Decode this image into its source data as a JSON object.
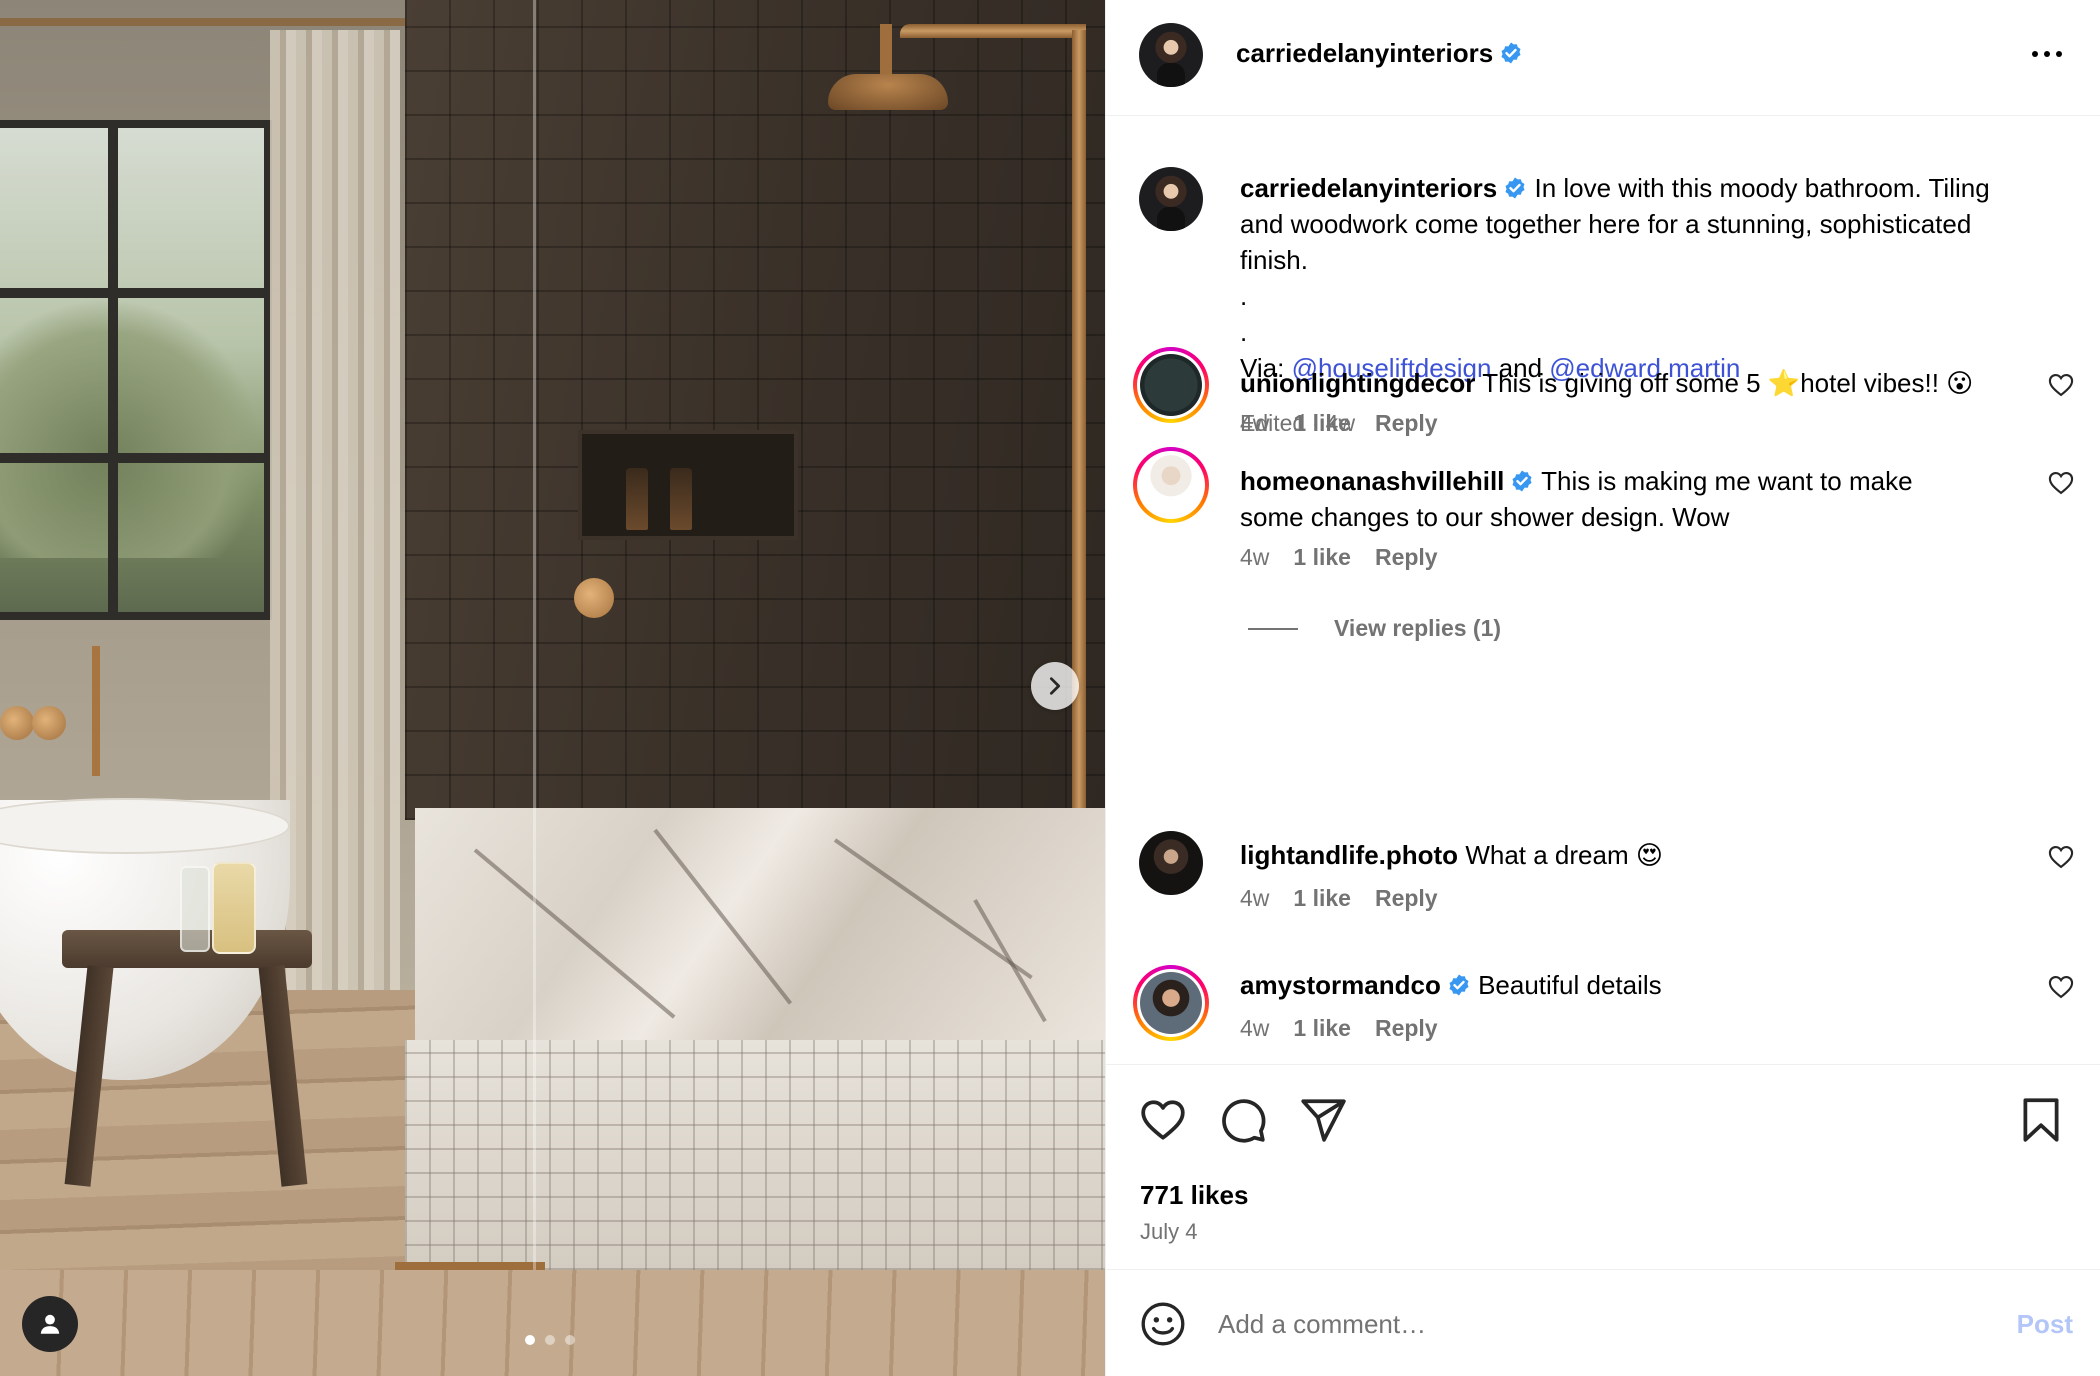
{
  "post": {
    "username": "carriedelanyinteriors",
    "verified": true,
    "carousel": {
      "slide_count": 3,
      "active_slide": 1
    }
  },
  "caption": {
    "username": "carriedelanyinteriors",
    "text_line1": "In love with this moody bathroom. Tiling",
    "text_line2": "and woodwork come together here for a stunning, sophisticated",
    "text_line3": "finish.",
    "dot1": ".",
    "dot2": ".",
    "via_prefix": "Via: ",
    "mention1": "@houseliftdesign",
    "and": " and ",
    "mention2": "@edward.martin",
    "meta": "Edited · 4w"
  },
  "comments": [
    {
      "username": "unionlightingdecor",
      "verified": false,
      "text": "This is giving off some 5 ⭐hotel vibes!! 😮",
      "time": "4w",
      "likes": "1 like",
      "reply": "Reply"
    },
    {
      "username": "homeonanashvillehill",
      "verified": true,
      "text_line1": "This is making me want to make",
      "text_line2": "some changes to our shower design. Wow",
      "time": "4w",
      "likes": "1 like",
      "reply": "Reply",
      "view_replies": "View replies (1)"
    },
    {
      "username": "lightandlife.photo",
      "verified": false,
      "text": "What a dream 😍",
      "time": "4w",
      "likes": "1 like",
      "reply": "Reply"
    },
    {
      "username": "amystormandco",
      "verified": true,
      "text": "Beautiful details",
      "time": "4w",
      "likes": "1 like",
      "reply": "Reply"
    }
  ],
  "footer": {
    "likes": "771 likes",
    "date": "July 4",
    "comment_placeholder": "Add a comment…",
    "post_label": "Post"
  },
  "icons": {
    "actions": [
      "heart-icon",
      "comment-icon",
      "share-icon",
      "bookmark-icon"
    ],
    "header": [
      "verified-badge-icon",
      "more-options-icon"
    ],
    "photo": [
      "chevron-right-icon",
      "user-tag-icon"
    ]
  },
  "colors": {
    "link": "#3d52d5",
    "muted": "#737373",
    "verified": "#3897f0",
    "post_disabled": "#b3c6f7"
  }
}
